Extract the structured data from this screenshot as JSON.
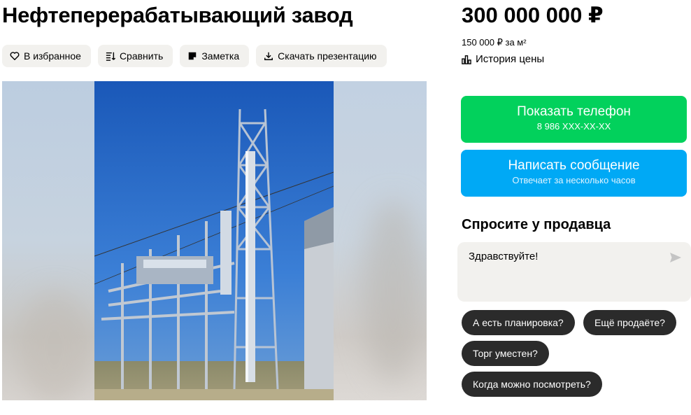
{
  "listing": {
    "title": "Нефтеперерабатывающий завод",
    "price": "300 000 000 ₽",
    "price_per_sqm": "150 000 ₽ за м²",
    "price_history": "История цены"
  },
  "actions": {
    "favorite": "В избранное",
    "compare": "Сравнить",
    "note": "Заметка",
    "download": "Скачать презентацию"
  },
  "contact": {
    "phone_label": "Показать телефон",
    "phone_masked": "8 986 XXX-XX-XX",
    "message_label": "Написать сообщение",
    "message_sub": "Отвечает за несколько часов",
    "phone_color": "#02d15c",
    "message_color": "#00a9f5"
  },
  "ask": {
    "title": "Спросите у продавца",
    "input_value": "Здравствуйте!",
    "suggestions": [
      "А есть планировка?",
      "Ещё продаёте?",
      "Торг уместен?",
      "Когда можно посмотреть?"
    ]
  }
}
